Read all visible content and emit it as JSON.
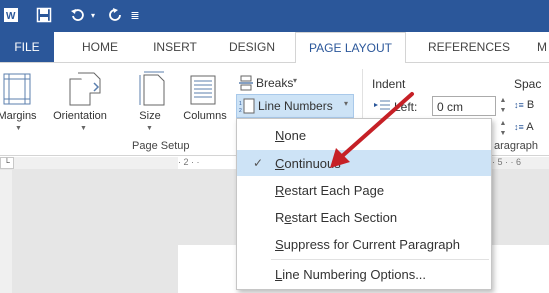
{
  "quick_access": {
    "save_icon": "save-icon",
    "undo_icon": "undo-icon",
    "redo_icon": "redo-icon",
    "customize_glyph": "≣"
  },
  "tabs": [
    {
      "label": "FILE"
    },
    {
      "label": "HOME"
    },
    {
      "label": "INSERT"
    },
    {
      "label": "DESIGN"
    },
    {
      "label": "PAGE LAYOUT",
      "active": true
    },
    {
      "label": "REFERENCES"
    },
    {
      "label": "M"
    }
  ],
  "page_setup": {
    "margins_label": "Margins",
    "orientation_label": "Orientation",
    "size_label": "Size",
    "columns_label": "Columns",
    "breaks_label": "Breaks",
    "line_numbers_label": "Line Numbers",
    "group_label": "Page Setup"
  },
  "paragraph": {
    "indent_label": "Indent",
    "left_label": "Left:",
    "left_value": "0 cm",
    "spacing_label": "Spac",
    "spacing_before_glyph": "B",
    "spacing_after_glyph": "A",
    "group_label": "aragraph"
  },
  "ruler": {
    "left_marks": "· 2 · ·",
    "right_marks": "· 5 · · 6"
  },
  "line_numbers_menu": {
    "items": [
      {
        "pre": "",
        "key": "N",
        "post": "one",
        "selected": false
      },
      {
        "pre": "",
        "key": "C",
        "post": "ontinuous",
        "selected": true
      },
      {
        "pre": "",
        "key": "R",
        "post": "estart Each Page",
        "selected": false
      },
      {
        "pre": "R",
        "key": "e",
        "post": "start Each Section",
        "selected": false
      },
      {
        "pre": "",
        "key": "S",
        "post": "uppress for Current Paragraph",
        "selected": false
      },
      {
        "pre": "",
        "key": "L",
        "post": "ine Numbering Options...",
        "selected": false
      }
    ],
    "check_glyph": "✓"
  },
  "colors": {
    "accent": "#2b579a",
    "arrow": "#c62026",
    "selection": "#cde3f6"
  }
}
